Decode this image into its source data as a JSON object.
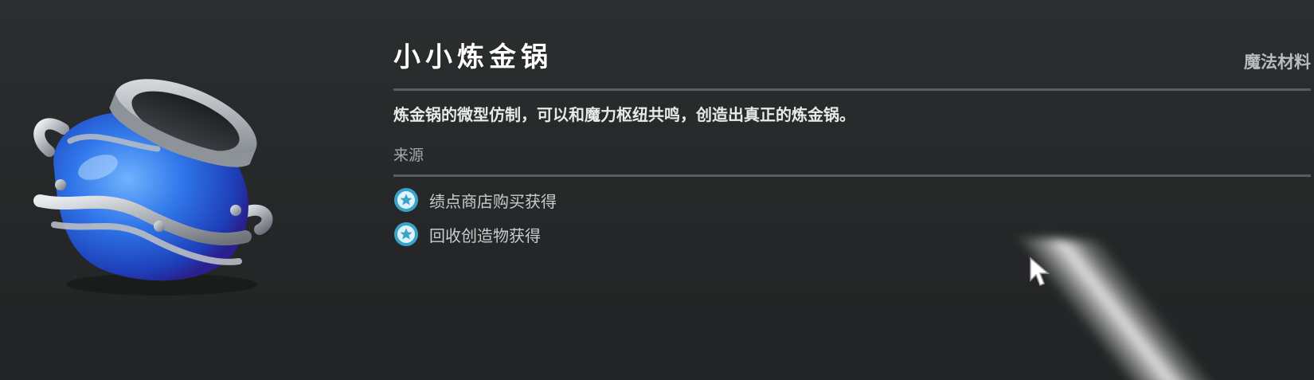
{
  "item": {
    "name": "小小炼金锅",
    "category": "魔法材料",
    "description": "炼金锅的微型仿制，可以和魔力枢纽共鸣，创造出真正的炼金锅。",
    "image_icon": "alchemy-pot-icon"
  },
  "sources": {
    "label": "来源",
    "items": [
      {
        "text": "绩点商店购买获得",
        "icon": "star-badge-icon"
      },
      {
        "text": "回收创造物获得",
        "icon": "star-badge-icon"
      }
    ]
  },
  "colors": {
    "background": "#262829",
    "title": "#ffffff",
    "category": "#b9bcbd",
    "divider": "#5a5d5e",
    "badge": "#3aa3c8"
  }
}
